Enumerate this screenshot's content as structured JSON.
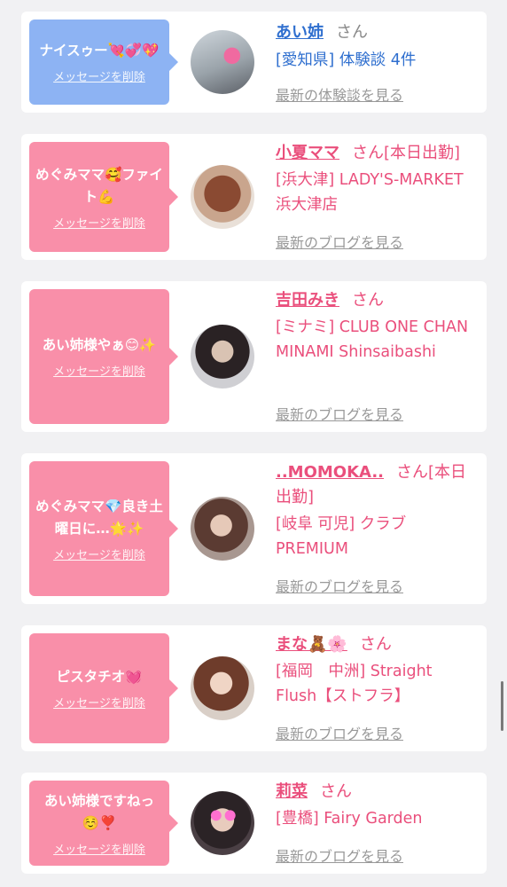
{
  "delete_label": "メッセージを削除",
  "cards": [
    {
      "message": "ナイスゥー💘💞💖",
      "name": "あい姉",
      "suffix": "さん",
      "shop": "[愛知県] 体験談 4件",
      "more": "最新の体験談を見る",
      "bubble_color": "#8db3f3"
    },
    {
      "message": "めぐみママ🥰ファイト💪",
      "name": "小夏ママ",
      "suffix": "さん[本日出勤]",
      "shop": "[浜大津] LADY'S-MARKET 浜大津店",
      "more": "最新のブログを見る",
      "bubble_color": "#f98fa9"
    },
    {
      "message": "あい姉様やぁ😊✨",
      "name": "吉田みき",
      "suffix": "さん",
      "shop": "[ミナミ] CLUB ONE CHAN MINAMI Shinsaibashi",
      "more": "最新のブログを見る",
      "bubble_color": "#f98fa9"
    },
    {
      "message": "めぐみママ💎良き土曜日に…🌟✨",
      "name": "..MOMOKA..",
      "suffix": "さん[本日出勤]",
      "shop": "[岐阜 可児] クラブPREMIUM",
      "more": "最新のブログを見る",
      "bubble_color": "#f98fa9"
    },
    {
      "message": "ピスタチオ💓",
      "name": "まな🧸🌸",
      "suffix": "さん",
      "shop": "[福岡　中洲] Straight Flush【ストフラ】",
      "more": "最新のブログを見る",
      "bubble_color": "#f98fa9"
    },
    {
      "message": "あい姉様ですねっ☺️❣️",
      "name": "莉菜",
      "suffix": "さん",
      "shop": "[豊橋] Fairy Garden",
      "more": "最新のブログを見る",
      "bubble_color": "#f98fa9"
    }
  ]
}
